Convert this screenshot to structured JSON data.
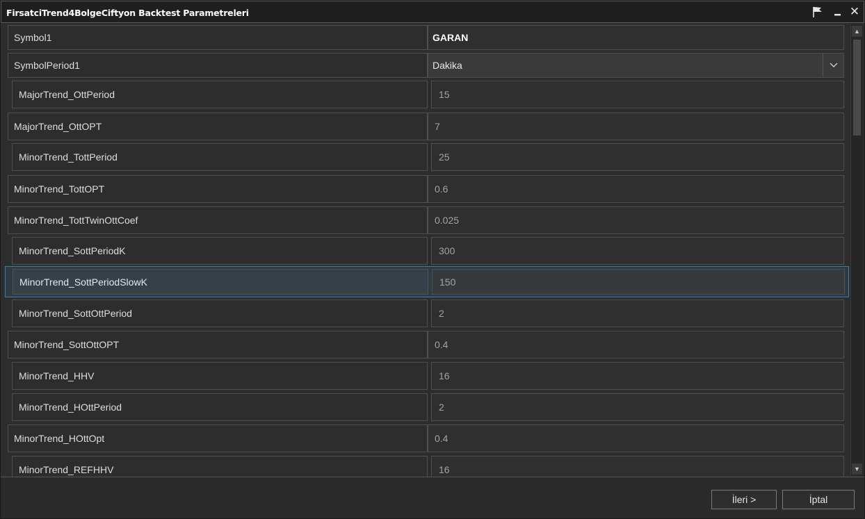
{
  "window": {
    "title": "FirsatciTrend4BolgeCiftyon Backtest Parametreleri"
  },
  "params": [
    {
      "label": "Symbol1",
      "value": "GARAN"
    },
    {
      "label": "SymbolPeriod1",
      "value": "Dakika"
    },
    {
      "label": "MajorTrend_OttPeriod",
      "value": "15"
    },
    {
      "label": "MajorTrend_OttOPT",
      "value": "7"
    },
    {
      "label": "MinorTrend_TottPeriod",
      "value": "25"
    },
    {
      "label": "MinorTrend_TottOPT",
      "value": "0.6"
    },
    {
      "label": "MinorTrend_TottTwinOttCoef",
      "value": "0.025"
    },
    {
      "label": "MinorTrend_SottPeriodK",
      "value": "300"
    },
    {
      "label": "MinorTrend_SottPeriodSlowK",
      "value": "150"
    },
    {
      "label": "MinorTrend_SottOttPeriod",
      "value": "2"
    },
    {
      "label": "MinorTrend_SottOttOPT",
      "value": "0.4"
    },
    {
      "label": "MinorTrend_HHV",
      "value": "16"
    },
    {
      "label": "MinorTrend_HOttPeriod",
      "value": "2"
    },
    {
      "label": "MinorTrend_HOttOpt",
      "value": "0.4"
    },
    {
      "label": "MinorTrend_REFHHV",
      "value": "16"
    }
  ],
  "footer": {
    "next_label": "İleri >",
    "cancel_label": "İptal"
  },
  "icons": {
    "titlebar": [
      "flag-icon",
      "minimize-icon",
      "close-icon"
    ],
    "dropdown": "chevron-down-icon",
    "scroll": [
      "arrow-up-icon",
      "arrow-down-icon"
    ]
  },
  "colors": {
    "selected_row_border": "#3f7ea1",
    "background": "#2d2d2d"
  }
}
